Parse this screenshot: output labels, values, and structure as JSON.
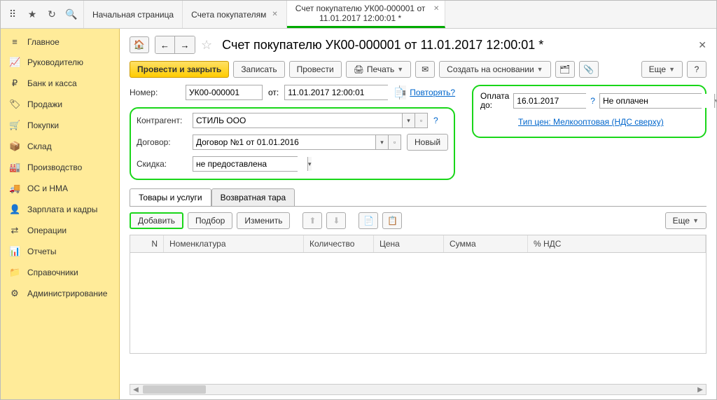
{
  "topbar": {
    "tabs": [
      {
        "label": "Начальная страница"
      },
      {
        "label": "Счета покупателям"
      },
      {
        "line1": "Счет покупателю УК00-000001 от",
        "line2": "11.01.2017 12:00:01 *"
      }
    ]
  },
  "sidebar": {
    "items": [
      {
        "label": "Главное",
        "icon": "≡"
      },
      {
        "label": "Руководителю",
        "icon": "📈"
      },
      {
        "label": "Банк и касса",
        "icon": "₽"
      },
      {
        "label": "Продажи",
        "icon": "🏷"
      },
      {
        "label": "Покупки",
        "icon": "🛒"
      },
      {
        "label": "Склад",
        "icon": "📦"
      },
      {
        "label": "Производство",
        "icon": "🏭"
      },
      {
        "label": "ОС и НМА",
        "icon": "🚚"
      },
      {
        "label": "Зарплата и кадры",
        "icon": "👤"
      },
      {
        "label": "Операции",
        "icon": "⇄"
      },
      {
        "label": "Отчеты",
        "icon": "📊"
      },
      {
        "label": "Справочники",
        "icon": "📁"
      },
      {
        "label": "Администрирование",
        "icon": "⚙"
      }
    ]
  },
  "doc": {
    "title": "Счет покупателю УК00-000001 от 11.01.2017 12:00:01 *"
  },
  "toolbar": {
    "post_close": "Провести и закрыть",
    "save": "Записать",
    "post": "Провести",
    "print": "Печать",
    "create_based": "Создать на основании",
    "more": "Еще"
  },
  "form": {
    "number_label": "Номер:",
    "number_value": "УК00-000001",
    "from_label": "от:",
    "date_value": "11.01.2017 12:00:01",
    "repeat": "Повторять?",
    "partner_label": "Контрагент:",
    "partner_value": "СТИЛЬ ООО",
    "contract_label": "Договор:",
    "contract_value": "Договор №1 от 01.01.2016",
    "new_btn": "Новый",
    "discount_label": "Скидка:",
    "discount_value": "не предоставлена"
  },
  "payment": {
    "label": "Оплата до:",
    "date": "16.01.2017",
    "status": "Не оплачен",
    "price_type": "Тип цен: Мелкооптовая (НДС сверху)"
  },
  "tabs2": {
    "goods": "Товары и услуги",
    "tare": "Возвратная тара"
  },
  "subtb": {
    "add": "Добавить",
    "pick": "Подбор",
    "edit": "Изменить",
    "more": "Еще"
  },
  "grid": {
    "cols": {
      "n": "N",
      "nom": "Номенклатура",
      "qty": "Количество",
      "price": "Цена",
      "sum": "Сумма",
      "nds": "% НДС"
    }
  }
}
